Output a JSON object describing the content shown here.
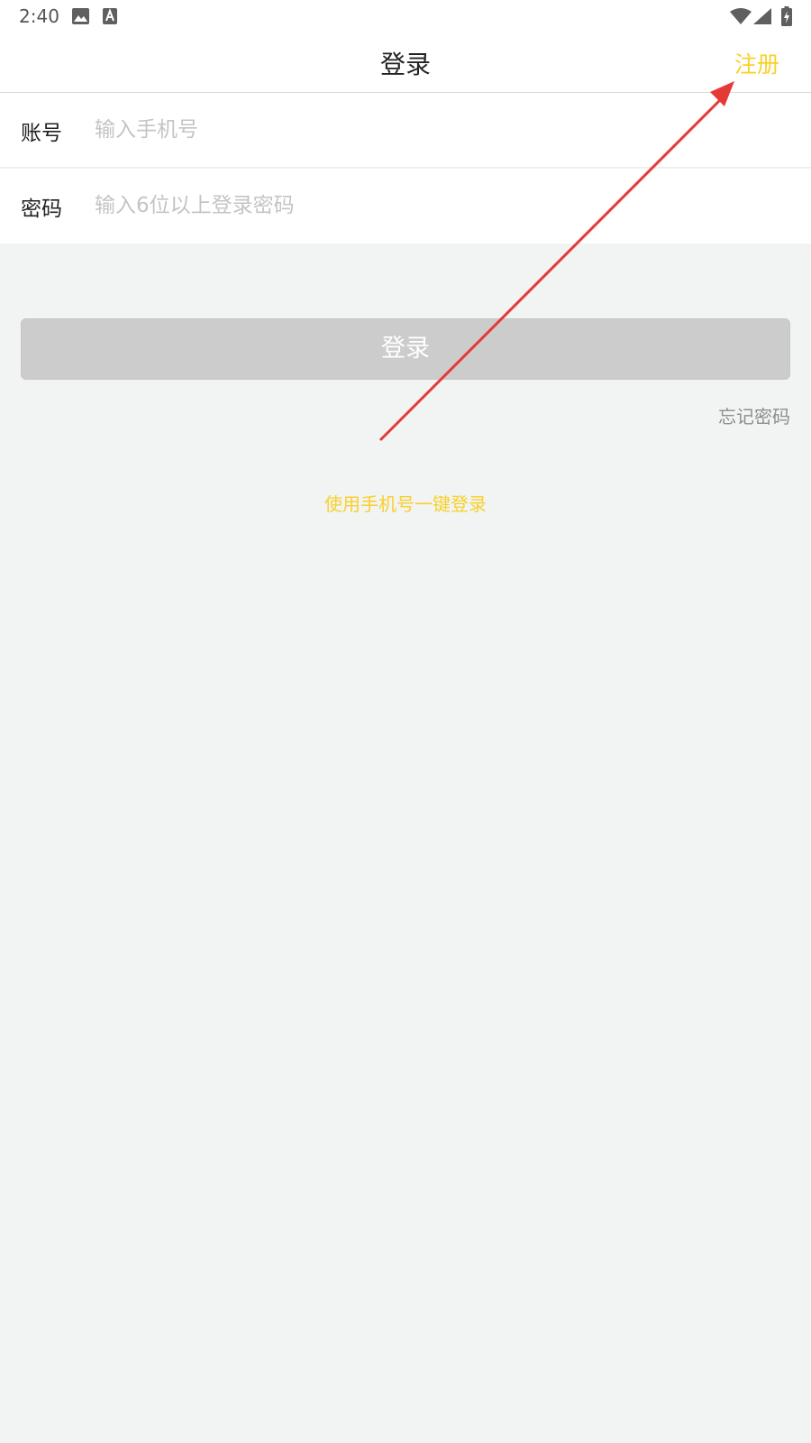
{
  "status_bar": {
    "time": "2:40",
    "icons": [
      "image-icon",
      "keyboard-a-icon",
      "wifi-icon",
      "signal-icon",
      "battery-charging-icon"
    ]
  },
  "nav": {
    "title": "登录",
    "register_label": "注册",
    "accent_color": "#f8d12a"
  },
  "form": {
    "account_label": "账号",
    "account_placeholder": "输入手机号",
    "password_label": "密码",
    "password_placeholder": "输入6位以上登录密码"
  },
  "login_button_label": "登录",
  "forgot_password_label": "忘记密码",
  "one_key_login_label": "使用手机号一键登录",
  "annotation": {
    "type": "arrow",
    "color": "#e53935"
  }
}
